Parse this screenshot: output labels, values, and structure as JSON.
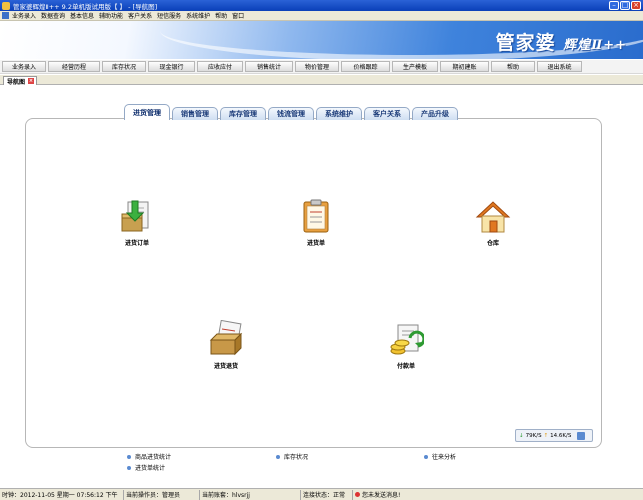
{
  "window": {
    "title": "管家婆辉煌Ⅱ++ 9.2单机版试用版【 】 - [导航图]"
  },
  "menu": [
    "业务录入",
    "数据查询",
    "基本信息",
    "辅助功能",
    "客户关系",
    "短信服务",
    "系统维护",
    "帮助",
    "窗口"
  ],
  "banner": {
    "logo": "管家婆",
    "logo_sub": "辉煌Ⅱ++"
  },
  "nav": [
    "业务录入",
    "经营历程",
    "库存状况",
    "现金银行",
    "应收应付",
    "销售统计",
    "物价管理",
    "价格跟踪",
    "生产模板",
    "期初建账",
    "帮助",
    "退出系统"
  ],
  "doc_tab": "导航图",
  "tabs": [
    "进货管理",
    "销售管理",
    "库存管理",
    "钱流管理",
    "系统维护",
    "客户关系",
    "产品升级"
  ],
  "icons": {
    "order": "进货订单",
    "purchase": "进货单",
    "warehouse": "仓库",
    "return": "进货退货",
    "payment": "付款单"
  },
  "speed": {
    "down": "79K/S",
    "up": "14.6K/S"
  },
  "links": [
    "商品进货统计",
    "库存状况",
    "往来分析",
    "进货单统计"
  ],
  "status": {
    "clock": "时钟：2012-11-05 星期一 07:56:12 下午",
    "operator": "当前操作员：管理员",
    "account": "当前账套：hlvsrjj",
    "conn": "连接状态：正常",
    "msg": "您未发送消息!"
  }
}
